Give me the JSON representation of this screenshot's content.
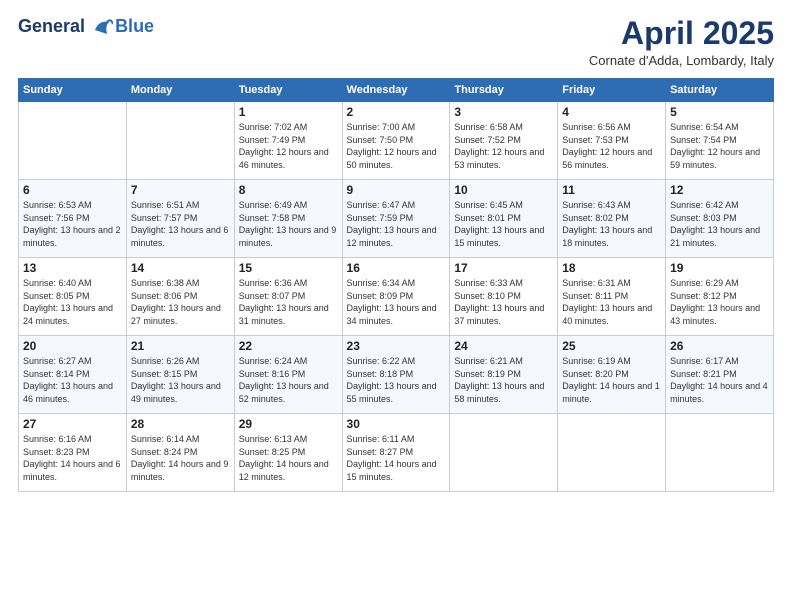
{
  "header": {
    "logo_line1": "General",
    "logo_line2": "Blue",
    "month_title": "April 2025",
    "location": "Cornate d'Adda, Lombardy, Italy"
  },
  "weekdays": [
    "Sunday",
    "Monday",
    "Tuesday",
    "Wednesday",
    "Thursday",
    "Friday",
    "Saturday"
  ],
  "weeks": [
    [
      {
        "day": "",
        "info": ""
      },
      {
        "day": "",
        "info": ""
      },
      {
        "day": "1",
        "info": "Sunrise: 7:02 AM\nSunset: 7:49 PM\nDaylight: 12 hours and 46 minutes."
      },
      {
        "day": "2",
        "info": "Sunrise: 7:00 AM\nSunset: 7:50 PM\nDaylight: 12 hours and 50 minutes."
      },
      {
        "day": "3",
        "info": "Sunrise: 6:58 AM\nSunset: 7:52 PM\nDaylight: 12 hours and 53 minutes."
      },
      {
        "day": "4",
        "info": "Sunrise: 6:56 AM\nSunset: 7:53 PM\nDaylight: 12 hours and 56 minutes."
      },
      {
        "day": "5",
        "info": "Sunrise: 6:54 AM\nSunset: 7:54 PM\nDaylight: 12 hours and 59 minutes."
      }
    ],
    [
      {
        "day": "6",
        "info": "Sunrise: 6:53 AM\nSunset: 7:56 PM\nDaylight: 13 hours and 2 minutes."
      },
      {
        "day": "7",
        "info": "Sunrise: 6:51 AM\nSunset: 7:57 PM\nDaylight: 13 hours and 6 minutes."
      },
      {
        "day": "8",
        "info": "Sunrise: 6:49 AM\nSunset: 7:58 PM\nDaylight: 13 hours and 9 minutes."
      },
      {
        "day": "9",
        "info": "Sunrise: 6:47 AM\nSunset: 7:59 PM\nDaylight: 13 hours and 12 minutes."
      },
      {
        "day": "10",
        "info": "Sunrise: 6:45 AM\nSunset: 8:01 PM\nDaylight: 13 hours and 15 minutes."
      },
      {
        "day": "11",
        "info": "Sunrise: 6:43 AM\nSunset: 8:02 PM\nDaylight: 13 hours and 18 minutes."
      },
      {
        "day": "12",
        "info": "Sunrise: 6:42 AM\nSunset: 8:03 PM\nDaylight: 13 hours and 21 minutes."
      }
    ],
    [
      {
        "day": "13",
        "info": "Sunrise: 6:40 AM\nSunset: 8:05 PM\nDaylight: 13 hours and 24 minutes."
      },
      {
        "day": "14",
        "info": "Sunrise: 6:38 AM\nSunset: 8:06 PM\nDaylight: 13 hours and 27 minutes."
      },
      {
        "day": "15",
        "info": "Sunrise: 6:36 AM\nSunset: 8:07 PM\nDaylight: 13 hours and 31 minutes."
      },
      {
        "day": "16",
        "info": "Sunrise: 6:34 AM\nSunset: 8:09 PM\nDaylight: 13 hours and 34 minutes."
      },
      {
        "day": "17",
        "info": "Sunrise: 6:33 AM\nSunset: 8:10 PM\nDaylight: 13 hours and 37 minutes."
      },
      {
        "day": "18",
        "info": "Sunrise: 6:31 AM\nSunset: 8:11 PM\nDaylight: 13 hours and 40 minutes."
      },
      {
        "day": "19",
        "info": "Sunrise: 6:29 AM\nSunset: 8:12 PM\nDaylight: 13 hours and 43 minutes."
      }
    ],
    [
      {
        "day": "20",
        "info": "Sunrise: 6:27 AM\nSunset: 8:14 PM\nDaylight: 13 hours and 46 minutes."
      },
      {
        "day": "21",
        "info": "Sunrise: 6:26 AM\nSunset: 8:15 PM\nDaylight: 13 hours and 49 minutes."
      },
      {
        "day": "22",
        "info": "Sunrise: 6:24 AM\nSunset: 8:16 PM\nDaylight: 13 hours and 52 minutes."
      },
      {
        "day": "23",
        "info": "Sunrise: 6:22 AM\nSunset: 8:18 PM\nDaylight: 13 hours and 55 minutes."
      },
      {
        "day": "24",
        "info": "Sunrise: 6:21 AM\nSunset: 8:19 PM\nDaylight: 13 hours and 58 minutes."
      },
      {
        "day": "25",
        "info": "Sunrise: 6:19 AM\nSunset: 8:20 PM\nDaylight: 14 hours and 1 minute."
      },
      {
        "day": "26",
        "info": "Sunrise: 6:17 AM\nSunset: 8:21 PM\nDaylight: 14 hours and 4 minutes."
      }
    ],
    [
      {
        "day": "27",
        "info": "Sunrise: 6:16 AM\nSunset: 8:23 PM\nDaylight: 14 hours and 6 minutes."
      },
      {
        "day": "28",
        "info": "Sunrise: 6:14 AM\nSunset: 8:24 PM\nDaylight: 14 hours and 9 minutes."
      },
      {
        "day": "29",
        "info": "Sunrise: 6:13 AM\nSunset: 8:25 PM\nDaylight: 14 hours and 12 minutes."
      },
      {
        "day": "30",
        "info": "Sunrise: 6:11 AM\nSunset: 8:27 PM\nDaylight: 14 hours and 15 minutes."
      },
      {
        "day": "",
        "info": ""
      },
      {
        "day": "",
        "info": ""
      },
      {
        "day": "",
        "info": ""
      }
    ]
  ]
}
